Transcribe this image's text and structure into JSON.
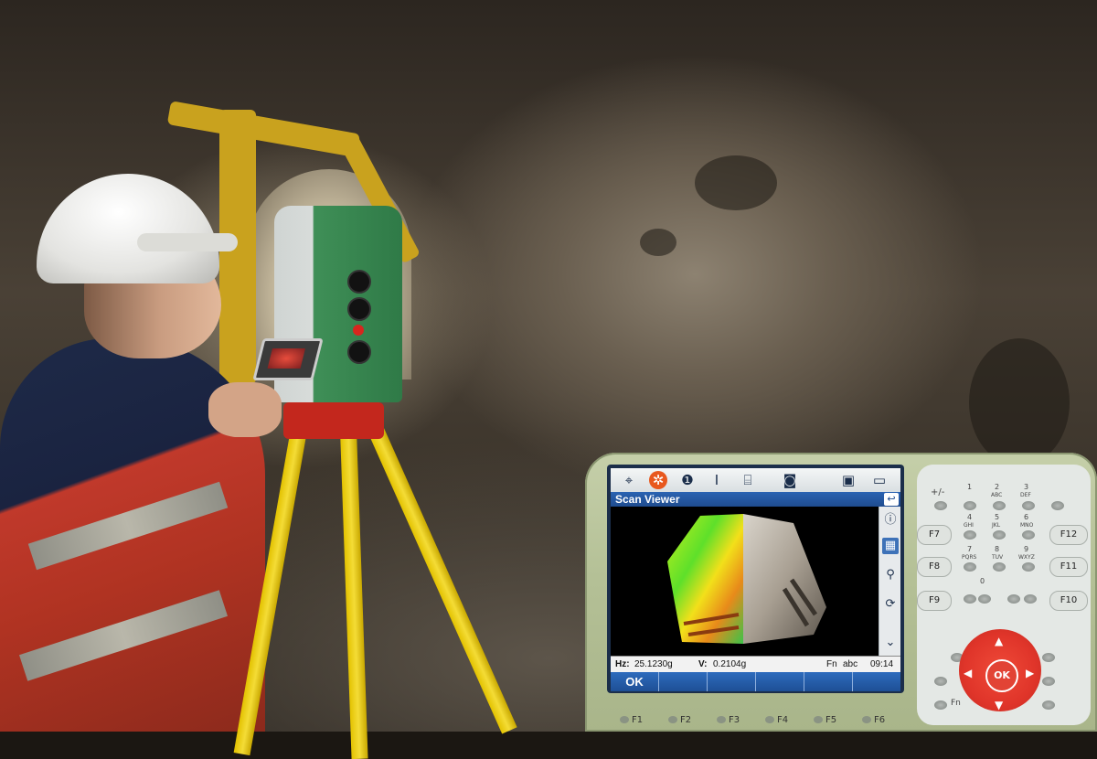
{
  "toolbar": {
    "icons": [
      "crosshair-icon",
      "survey-star-icon",
      "info-number-icon",
      "text-cursor-icon",
      "instrument-icon",
      "camera-icon",
      "sd-card-icon",
      "battery-icon"
    ]
  },
  "window": {
    "title": "Scan Viewer",
    "back_glyph": "↩"
  },
  "side_tools": [
    "info-icon",
    "scan-mode-icon",
    "zoom-icon",
    "rotate-icon",
    "expand-down-icon"
  ],
  "status": {
    "hz_label": "Hz:",
    "hz_value": "25.1230g",
    "v_label": "V:",
    "v_value": "0.2104g",
    "fn": "Fn",
    "input_mode": "abc",
    "time": "09:14"
  },
  "softkeys": {
    "ok": "OK"
  },
  "keypad": {
    "plus_minus": "+/-",
    "keys": [
      {
        "num": "1",
        "sub": ""
      },
      {
        "num": "2",
        "sub": "ABC"
      },
      {
        "num": "3",
        "sub": "DEF"
      },
      {
        "num": "4",
        "sub": "GHI"
      },
      {
        "num": "5",
        "sub": "JKL"
      },
      {
        "num": "6",
        "sub": "MNO"
      },
      {
        "num": "7",
        "sub": "PQRS"
      },
      {
        "num": "8",
        "sub": "TUV"
      },
      {
        "num": "9",
        "sub": "WXYZ"
      },
      {
        "num": "0",
        "sub": ""
      }
    ],
    "f_left": [
      "F7",
      "F8",
      "F9"
    ],
    "f_right": [
      "F12",
      "F11",
      "F10"
    ],
    "ok": "OK",
    "fn": "Fn"
  },
  "bottom_fkeys": [
    "F1",
    "F2",
    "F3",
    "F4",
    "F5",
    "F6"
  ]
}
